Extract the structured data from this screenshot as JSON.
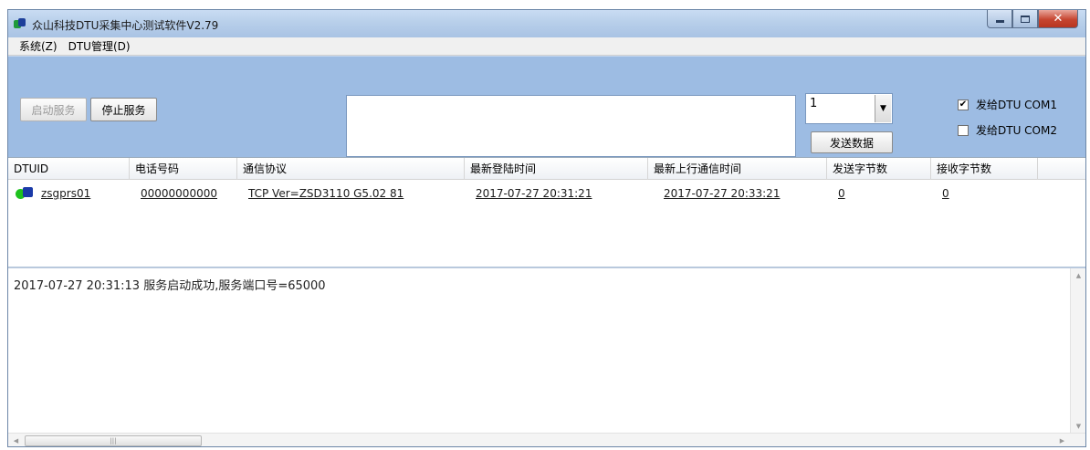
{
  "window": {
    "title": "众山科技DTU采集中心测试软件V2.79"
  },
  "menu": [
    {
      "label": "系统(Z)"
    },
    {
      "label": "DTU管理(D)"
    }
  ],
  "toolbar": {
    "start_label": "启动服务",
    "stop_label": "停止服务",
    "message_value": "",
    "combo_value": "1",
    "send_label": "发送数据",
    "checkboxes": [
      {
        "label": "发给DTU COM1",
        "checked": true
      },
      {
        "label": "发给DTU COM2",
        "checked": false
      }
    ]
  },
  "grid": {
    "headers": [
      "DTUID",
      "电话号码",
      "通信协议",
      "最新登陆时间",
      "最新上行通信时间",
      "发送字节数",
      "接收字节数"
    ],
    "rows": [
      {
        "dtuid": "zsgprs01",
        "phone": "00000000000",
        "protocol": "TCP Ver=ZSD3110 G5.02 81",
        "login_time": "2017-07-27 20:31:21",
        "uplink_time": "2017-07-27 20:33:21",
        "sent_bytes": "0",
        "recv_bytes": "0"
      }
    ]
  },
  "log": {
    "lines": [
      "2017-07-27 20:31:13 服务启动成功,服务端口号=65000"
    ]
  },
  "icons": {
    "app": "dtu-app-icon",
    "dtu_status": "dtu-online-icon",
    "combo_arrow": "chevron-down-icon"
  }
}
